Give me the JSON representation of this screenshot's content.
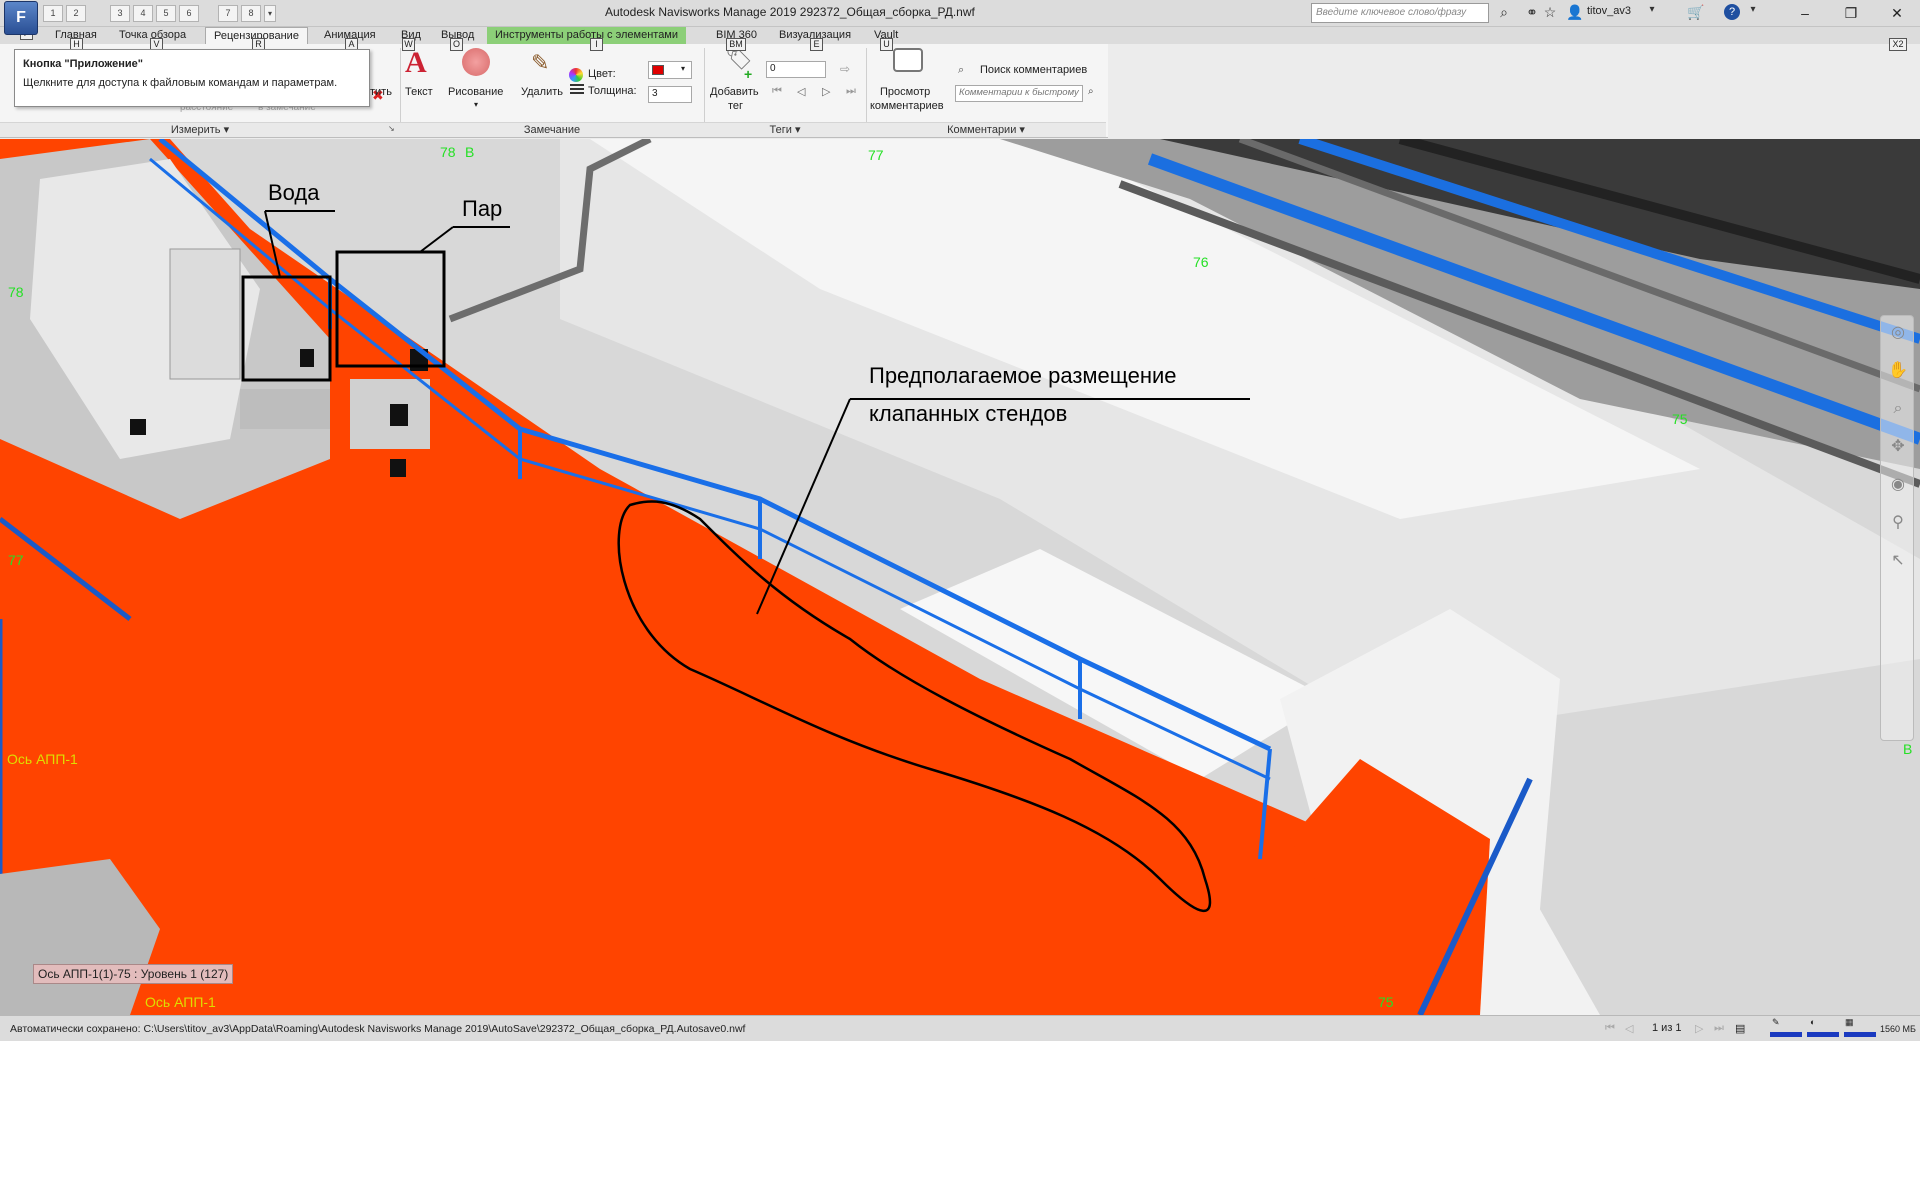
{
  "window": {
    "app_button": "F",
    "title": "Autodesk Navisworks Manage 2019    292372_Общая_сборка_РД.nwf",
    "search_placeholder": "Введите ключевое слово/фразу",
    "user": "titov_av3"
  },
  "qat": [
    "1",
    "2",
    "3",
    "4",
    "5",
    "6",
    "7",
    "8"
  ],
  "tabs": [
    {
      "label": "Главная",
      "key": "H"
    },
    {
      "label": "Точка обзора",
      "key": "V"
    },
    {
      "label": "Рецензирование",
      "key": "R"
    },
    {
      "label": "Анимация",
      "key": "A"
    },
    {
      "label": "Вид",
      "key": "W"
    },
    {
      "label": "Вывод",
      "key": "O"
    },
    {
      "label": "Инструменты работы с элементами",
      "key": "I"
    },
    {
      "label": "BIM 360",
      "key": "BM"
    },
    {
      "label": "Визуализация",
      "key": "E"
    },
    {
      "label": "Vault",
      "key": "U"
    }
  ],
  "tab_corner_key": "X2",
  "tooltip": {
    "title": "Кнопка \"Приложение\"",
    "body": "Щелкните для доступа к файловым командам и параметрам."
  },
  "ribbon": {
    "measure": {
      "panel": "Измерить",
      "clear_label": "тить",
      "faded_left": "расстояние",
      "faded_right": "в замечание"
    },
    "redline": {
      "panel": "Замечание",
      "text": "Текст",
      "draw": "Рисование",
      "erase": "Удалить",
      "color_label": "Цвет:",
      "thickness_label": "Толщина:",
      "thickness_value": "3",
      "color_value": "#e00000"
    },
    "tags": {
      "panel": "Теги",
      "add_tag_line1": "Добавить",
      "add_tag_line2": "тег",
      "tag_value": "0"
    },
    "comments": {
      "panel": "Комментарии",
      "view_line1": "Просмотр",
      "view_line2": "комментариев",
      "find": "Поиск комментариев",
      "quick_find_placeholder": "Комментарии к быстрому"
    }
  },
  "viewport": {
    "markups": {
      "water": "Вода",
      "steam": "Пар",
      "placement_line1": "Предполагаемое размещение",
      "placement_line2": "клапанных стендов"
    },
    "levels": [
      "78",
      "В",
      "77",
      "76",
      "75",
      "78",
      "77",
      "В",
      "75"
    ],
    "axes": [
      "Ось АПП-1",
      "Ось АПП-1"
    ],
    "view_tooltip": "Ось АПП-1(1)-75 : Уровень 1 (127)"
  },
  "status": {
    "autosave": "Автоматически сохранено: C:\\Users\\titov_av3\\AppData\\Roaming\\Autodesk Navisworks Manage 2019\\AutoSave\\292372_Общая_сборка_РД.Autosave0.nwf",
    "pages": "1 из 1",
    "memory": "1560 МБ"
  }
}
